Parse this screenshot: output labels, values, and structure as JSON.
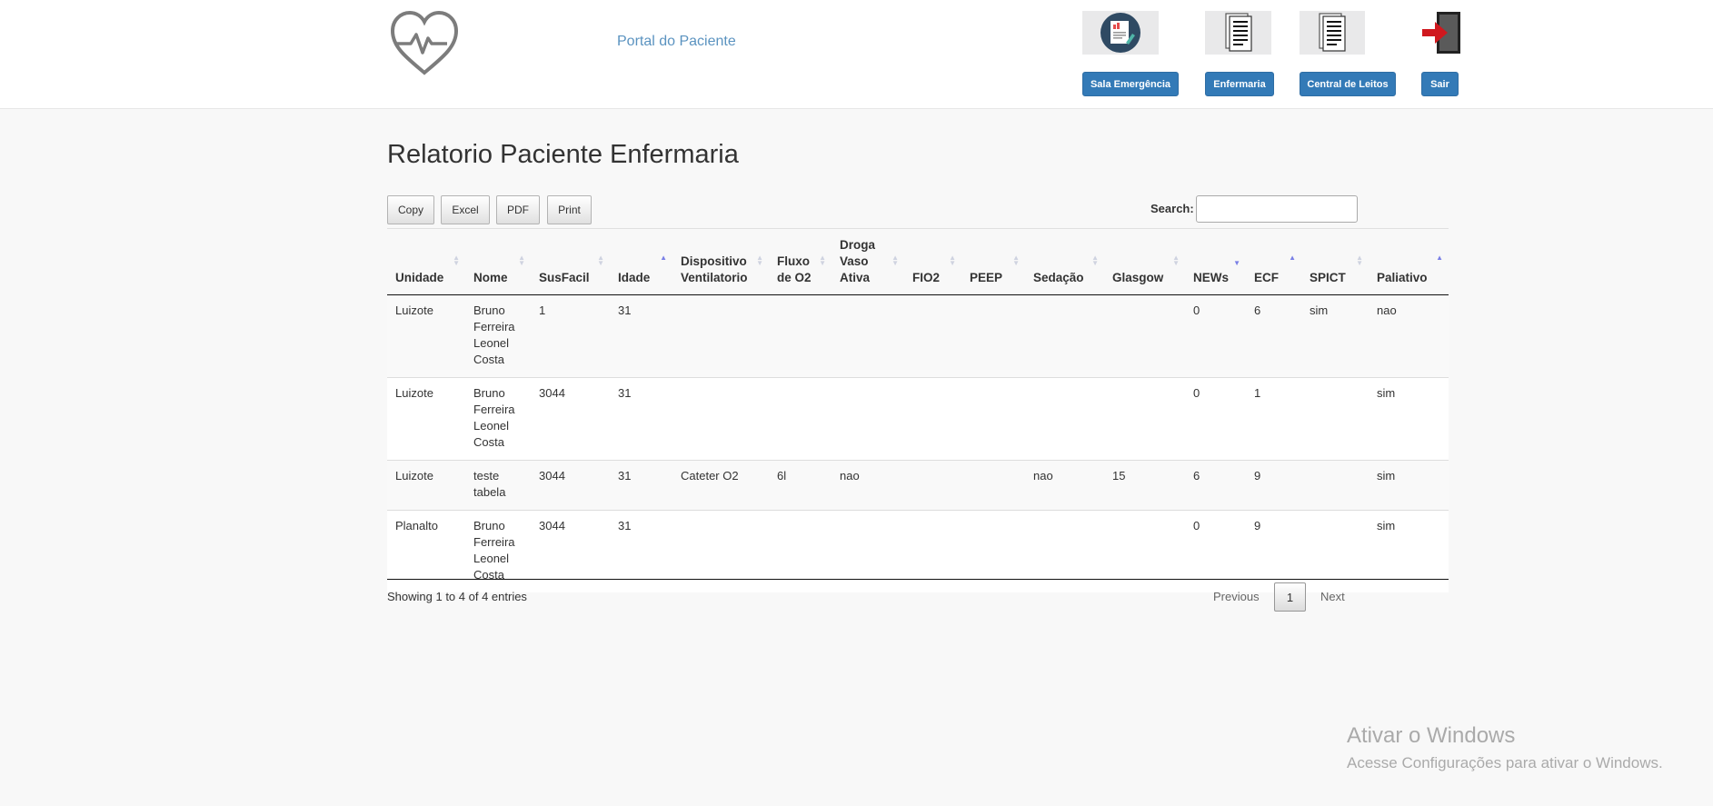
{
  "header": {
    "portal_title": "Portal do Paciente",
    "nav": [
      {
        "label": "Sala Emergência",
        "icon": "report-icon"
      },
      {
        "label": "Enfermaria",
        "icon": "document-icon"
      },
      {
        "label": "Central de Leitos",
        "icon": "document-icon"
      },
      {
        "label": "Sair",
        "icon": "exit-door-icon"
      }
    ],
    "accent_color": "#337ab7"
  },
  "page": {
    "title": "Relatorio Paciente Enfermaria"
  },
  "toolbar": {
    "buttons": [
      "Copy",
      "Excel",
      "PDF",
      "Print"
    ],
    "search_label": "Search:",
    "search_value": ""
  },
  "table": {
    "columns": [
      {
        "label": "Unidade",
        "sort": "none"
      },
      {
        "label": "Nome",
        "sort": "none"
      },
      {
        "label": "SusFacil",
        "sort": "none"
      },
      {
        "label": "Idade",
        "sort": "asc"
      },
      {
        "label": "Dispositivo Ventilatorio",
        "sort": "none"
      },
      {
        "label": "Fluxo de O2",
        "sort": "none"
      },
      {
        "label": "Droga Vaso Ativa",
        "sort": "none"
      },
      {
        "label": "FIO2",
        "sort": "none"
      },
      {
        "label": "PEEP",
        "sort": "none"
      },
      {
        "label": "Sedação",
        "sort": "none"
      },
      {
        "label": "Glasgow",
        "sort": "none"
      },
      {
        "label": "NEWs",
        "sort": "desc"
      },
      {
        "label": "ECF",
        "sort": "asc"
      },
      {
        "label": "SPICT",
        "sort": "none"
      },
      {
        "label": "Paliativo",
        "sort": "asc"
      }
    ],
    "rows": [
      [
        "Luizote",
        "Bruno Ferreira Leonel Costa",
        "1",
        "31",
        "",
        "",
        "",
        "",
        "",
        "",
        "",
        "0",
        "6",
        "sim",
        "nao"
      ],
      [
        "Luizote",
        "Bruno Ferreira Leonel Costa",
        "3044",
        "31",
        "",
        "",
        "",
        "",
        "",
        "",
        "",
        "0",
        "1",
        "",
        "sim"
      ],
      [
        "Luizote",
        "teste tabela",
        "3044",
        "31",
        "Cateter O2",
        "6l",
        "nao",
        "",
        "",
        "nao",
        "15",
        "6",
        "9",
        "",
        "sim"
      ],
      [
        "Planalto",
        "Bruno Ferreira Leonel Costa",
        "3044",
        "31",
        "",
        "",
        "",
        "",
        "",
        "",
        "",
        "0",
        "9",
        "",
        "sim"
      ]
    ]
  },
  "footer": {
    "info": "Showing 1 to 4 of 4 entries",
    "prev": "Previous",
    "current_page": "1",
    "next": "Next"
  },
  "watermark": {
    "title": "Ativar o Windows",
    "subtitle": "Acesse Configurações para ativar o Windows."
  }
}
